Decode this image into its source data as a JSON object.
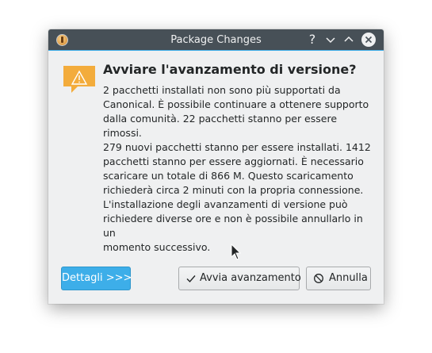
{
  "window": {
    "title": "Package Changes",
    "app_icon": "update-manager-icon",
    "controls": {
      "help": "?",
      "minimize": "chevron-down-icon",
      "maximize": "chevron-up-icon",
      "close": "close-icon"
    },
    "accent_color": "#3daee9",
    "titlebar_color": "#475057"
  },
  "dialog": {
    "icon": "warning-icon",
    "heading": "Avviare l'avanzamento di versione?",
    "message_lines": [
      "2 pacchetti installati non sono più supportati da",
      "Canonical. È possibile continuare a ottenere supporto",
      "dalla comunità. 22 pacchetti stanno per essere rimossi.",
      "279 nuovi pacchetti stanno per essere installati. 1412",
      "pacchetti stanno per essere aggiornati. È necessario",
      "scaricare un totale di 866 M. Questo scaricamento",
      "richiederà circa 2 minuti con la propria connessione.",
      "L'installazione degli avanzamenti di versione può",
      "richiedere diverse ore e non è possibile annullarlo in un",
      "momento successivo."
    ]
  },
  "buttons": {
    "details": "Dettagli >>>",
    "upgrade": "Avvia avanzamento",
    "cancel": "Annulla"
  }
}
